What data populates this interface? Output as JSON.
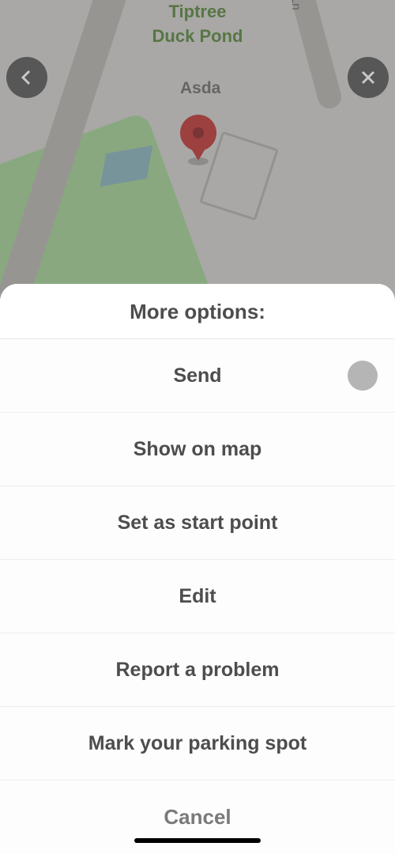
{
  "map": {
    "labels": {
      "poi_store": "Asda",
      "poi_pond_line1": "Tiptree",
      "poi_pond_line2": "Duck Pond",
      "road_suffix": "Ln"
    }
  },
  "sheet": {
    "title": "More options:",
    "items": [
      {
        "label": "Send"
      },
      {
        "label": "Show on map"
      },
      {
        "label": "Set as start point"
      },
      {
        "label": "Edit"
      },
      {
        "label": "Report a problem"
      },
      {
        "label": "Mark your parking spot"
      }
    ],
    "cancel_label": "Cancel"
  }
}
